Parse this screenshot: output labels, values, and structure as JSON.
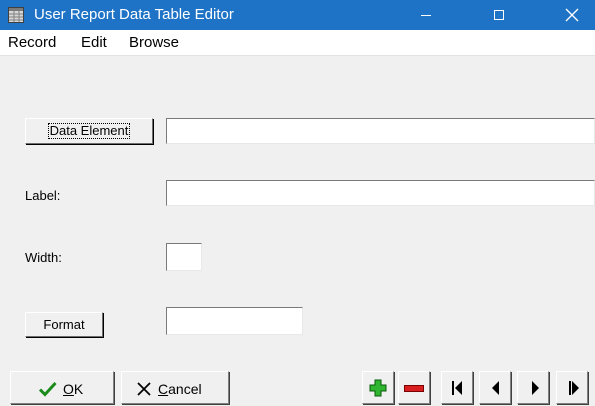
{
  "window": {
    "title": "User Report Data Table Editor",
    "title_bar_color": "#1e73c6",
    "icon": "data-table-app-icon"
  },
  "menu": {
    "items": [
      {
        "label": "Record"
      },
      {
        "label": "Edit"
      },
      {
        "label": "Browse"
      }
    ]
  },
  "form": {
    "data_element_button": "Data Element",
    "data_element_value": "",
    "label_label": "Label:",
    "label_value": "",
    "width_label": "Width:",
    "width_value": "",
    "format_button": "Format",
    "format_value": ""
  },
  "footer": {
    "ok": {
      "accel": "O",
      "rest": "K",
      "icon": "checkmark-icon"
    },
    "cancel": {
      "accel": "C",
      "rest": "ancel",
      "icon": "x-icon"
    },
    "nav_icons": [
      "add-record-icon",
      "delete-record-icon",
      "first-record-icon",
      "previous-record-icon",
      "next-record-icon",
      "last-record-icon"
    ]
  }
}
